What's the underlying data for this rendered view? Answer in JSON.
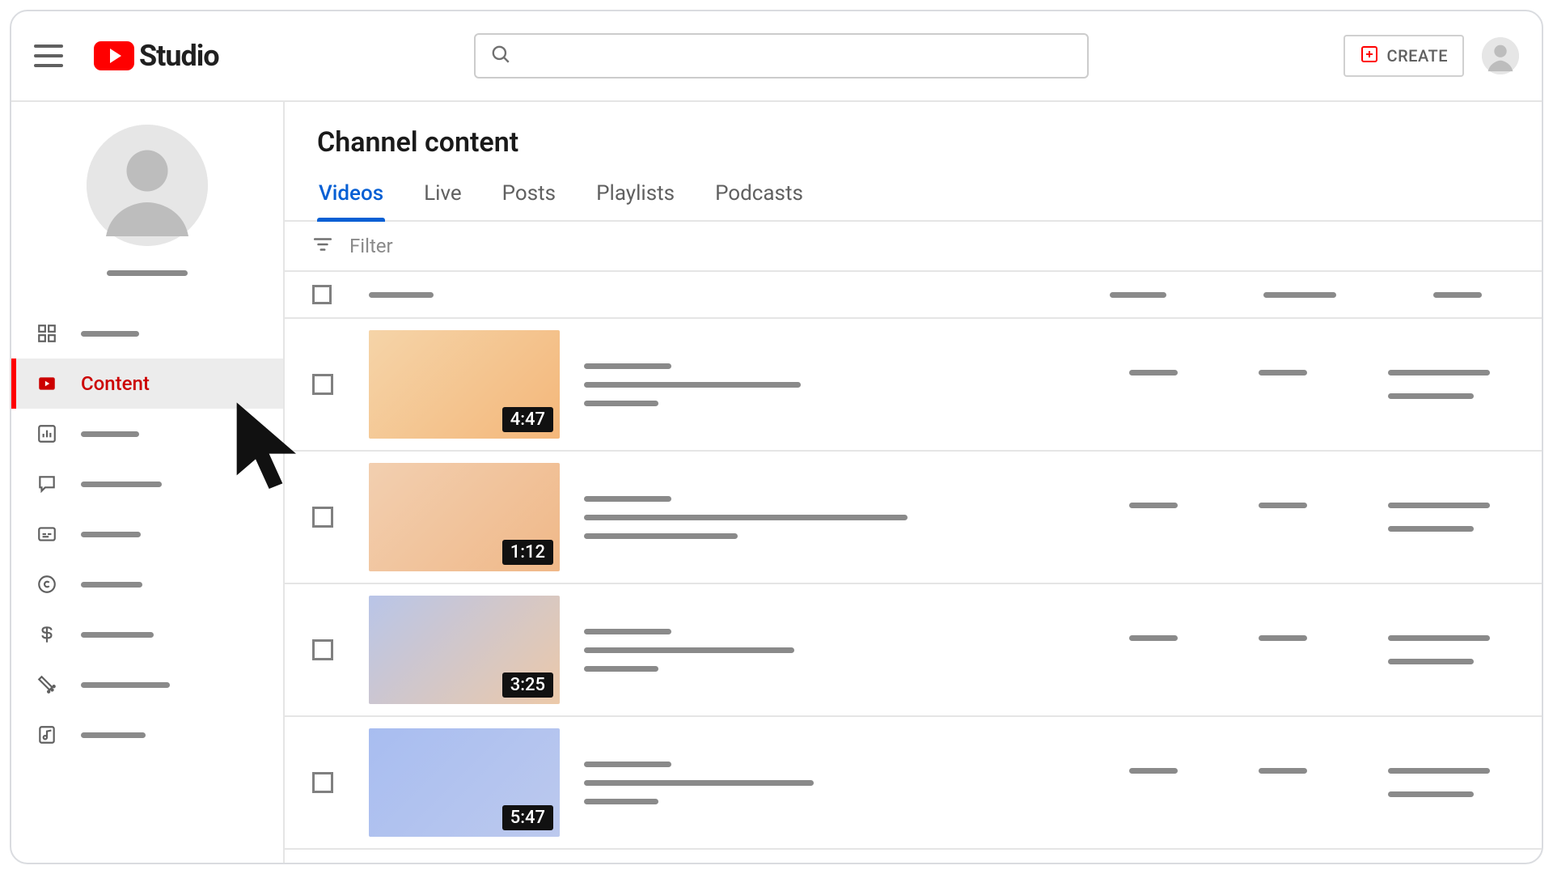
{
  "header": {
    "logo_text": "Studio",
    "create_label": "CREATE",
    "search_placeholder": ""
  },
  "sidebar": {
    "active_index": 1,
    "items": [
      {
        "icon": "dashboard",
        "label": ""
      },
      {
        "icon": "content",
        "label": "Content"
      },
      {
        "icon": "analytics",
        "label": ""
      },
      {
        "icon": "comments",
        "label": ""
      },
      {
        "icon": "subtitles",
        "label": ""
      },
      {
        "icon": "copyright",
        "label": ""
      },
      {
        "icon": "earn",
        "label": ""
      },
      {
        "icon": "customize",
        "label": ""
      },
      {
        "icon": "audio",
        "label": ""
      }
    ]
  },
  "main": {
    "page_title": "Channel content",
    "tabs": [
      "Videos",
      "Live",
      "Posts",
      "Playlists",
      "Podcasts"
    ],
    "active_tab": 0,
    "filter_label": "Filter",
    "videos": [
      {
        "duration": "4:47",
        "thumb": "orange"
      },
      {
        "duration": "1:12",
        "thumb": "orange2"
      },
      {
        "duration": "3:25",
        "thumb": "mid"
      },
      {
        "duration": "5:47",
        "thumb": "blue"
      }
    ]
  },
  "colors": {
    "accent_red": "#ff0000",
    "link_blue": "#065fd4"
  }
}
